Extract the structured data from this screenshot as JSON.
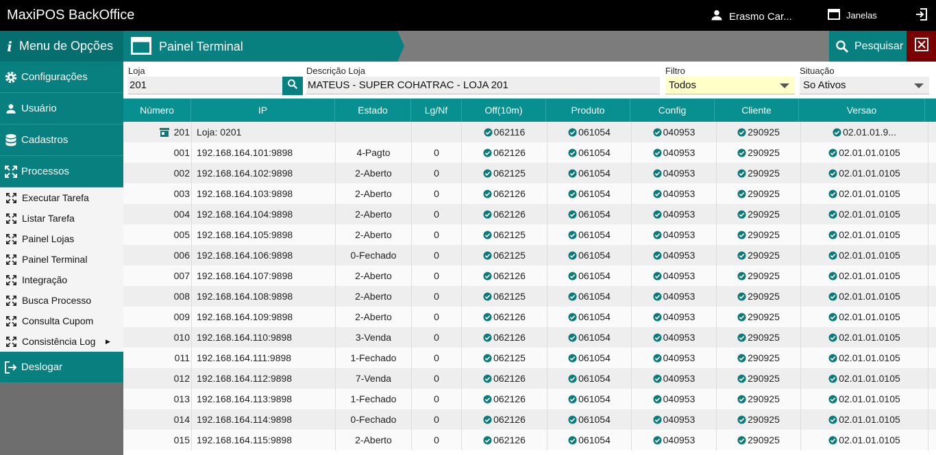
{
  "app": {
    "title": "MaxiPOS BackOffice",
    "user": "Erasmo Car...",
    "windows_label": "Janelas",
    "icons": {
      "user": "person-icon",
      "windows": "window-icon",
      "exit": "exit-icon"
    }
  },
  "sidebar": {
    "header": "Menu de Opções",
    "items": [
      {
        "label": "Configurações",
        "icon": "gear-icon"
      },
      {
        "label": "Usuário",
        "icon": "person-icon"
      },
      {
        "label": "Cadastros",
        "icon": "database-icon"
      },
      {
        "label": "Processos",
        "icon": "expand-icon"
      }
    ],
    "subitems": [
      {
        "label": "Executar Tarefa"
      },
      {
        "label": "Listar Tarefa"
      },
      {
        "label": "Painel Lojas"
      },
      {
        "label": "Painel Terminal"
      },
      {
        "label": "Integração"
      },
      {
        "label": "Busca Processo"
      },
      {
        "label": "Consulta Cupom"
      },
      {
        "label": "Consistência Log",
        "has_submenu": true
      }
    ],
    "logout": "Deslogar"
  },
  "panel": {
    "title": "Painel Terminal",
    "search_label": "Pesquisar"
  },
  "filters": {
    "loja_label": "Loja",
    "loja_value": "201",
    "descricao_label": "Descrição Loja",
    "descricao_value": "MATEUS - SUPER COHATRAC - LOJA 201",
    "filtro_label": "Filtro",
    "filtro_value": "Todos",
    "situacao_label": "Situação",
    "situacao_value": "So Ativos"
  },
  "table": {
    "headers": [
      "Número",
      "IP",
      "Estado",
      "Lg/Nf",
      "Off(10m)",
      "Produto",
      "Config",
      "Cliente",
      "Versao"
    ],
    "store_row": {
      "numero": "201",
      "ip": "Loja: 0201",
      "estado": "",
      "lgnf": "",
      "off": "062116",
      "produto": "061054",
      "config": "040953",
      "cliente": "290925",
      "versao": "02.01.01.9..."
    },
    "rows": [
      {
        "numero": "001",
        "ip": "192.168.164.101:9898",
        "estado": "4-Pagto",
        "lgnf": "0",
        "off": "062126",
        "produto": "061054",
        "config": "040953",
        "cliente": "290925",
        "versao": "02.01.01.0105"
      },
      {
        "numero": "002",
        "ip": "192.168.164.102:9898",
        "estado": "2-Aberto",
        "lgnf": "0",
        "off": "062125",
        "produto": "061054",
        "config": "040953",
        "cliente": "290925",
        "versao": "02.01.01.0105"
      },
      {
        "numero": "003",
        "ip": "192.168.164.103:9898",
        "estado": "2-Aberto",
        "lgnf": "0",
        "off": "062126",
        "produto": "061054",
        "config": "040953",
        "cliente": "290925",
        "versao": "02.01.01.0105"
      },
      {
        "numero": "004",
        "ip": "192.168.164.104:9898",
        "estado": "2-Aberto",
        "lgnf": "0",
        "off": "062126",
        "produto": "061054",
        "config": "040953",
        "cliente": "290925",
        "versao": "02.01.01.0105"
      },
      {
        "numero": "005",
        "ip": "192.168.164.105:9898",
        "estado": "2-Aberto",
        "lgnf": "0",
        "off": "062125",
        "produto": "061054",
        "config": "040953",
        "cliente": "290925",
        "versao": "02.01.01.0105"
      },
      {
        "numero": "006",
        "ip": "192.168.164.106:9898",
        "estado": "0-Fechado",
        "lgnf": "0",
        "off": "062125",
        "produto": "061054",
        "config": "040953",
        "cliente": "290925",
        "versao": "02.01.01.0105"
      },
      {
        "numero": "007",
        "ip": "192.168.164.107:9898",
        "estado": "2-Aberto",
        "lgnf": "0",
        "off": "062126",
        "produto": "061054",
        "config": "040953",
        "cliente": "290925",
        "versao": "02.01.01.0105"
      },
      {
        "numero": "008",
        "ip": "192.168.164.108:9898",
        "estado": "2-Aberto",
        "lgnf": "0",
        "off": "062125",
        "produto": "061054",
        "config": "040953",
        "cliente": "290925",
        "versao": "02.01.01.0105"
      },
      {
        "numero": "009",
        "ip": "192.168.164.109:9898",
        "estado": "2-Aberto",
        "lgnf": "0",
        "off": "062126",
        "produto": "061054",
        "config": "040953",
        "cliente": "290925",
        "versao": "02.01.01.0105"
      },
      {
        "numero": "010",
        "ip": "192.168.164.110:9898",
        "estado": "3-Venda",
        "lgnf": "0",
        "off": "062126",
        "produto": "061054",
        "config": "040953",
        "cliente": "290925",
        "versao": "02.01.01.0105"
      },
      {
        "numero": "011",
        "ip": "192.168.164.111:9898",
        "estado": "1-Fechado",
        "lgnf": "0",
        "off": "062125",
        "produto": "061054",
        "config": "040953",
        "cliente": "290925",
        "versao": "02.01.01.0105"
      },
      {
        "numero": "012",
        "ip": "192.168.164.112:9898",
        "estado": "7-Venda",
        "lgnf": "0",
        "off": "062126",
        "produto": "061054",
        "config": "040953",
        "cliente": "290925",
        "versao": "02.01.01.0105"
      },
      {
        "numero": "013",
        "ip": "192.168.164.113:9898",
        "estado": "1-Fechado",
        "lgnf": "0",
        "off": "062126",
        "produto": "061054",
        "config": "040953",
        "cliente": "290925",
        "versao": "02.01.01.0105"
      },
      {
        "numero": "014",
        "ip": "192.168.164.114:9898",
        "estado": "0-Fechado",
        "lgnf": "0",
        "off": "062126",
        "produto": "061054",
        "config": "040953",
        "cliente": "290925",
        "versao": "02.01.01.0105"
      },
      {
        "numero": "015",
        "ip": "192.168.164.115:9898",
        "estado": "2-Aberto",
        "lgnf": "0",
        "off": "062126",
        "produto": "061054",
        "config": "040953",
        "cliente": "290925",
        "versao": "02.01.01.0105"
      }
    ]
  },
  "colors": {
    "teal": "#088080",
    "teal_dark": "#066e6e",
    "close_red": "#7a0000",
    "filter_highlight": "#ffffc8"
  }
}
